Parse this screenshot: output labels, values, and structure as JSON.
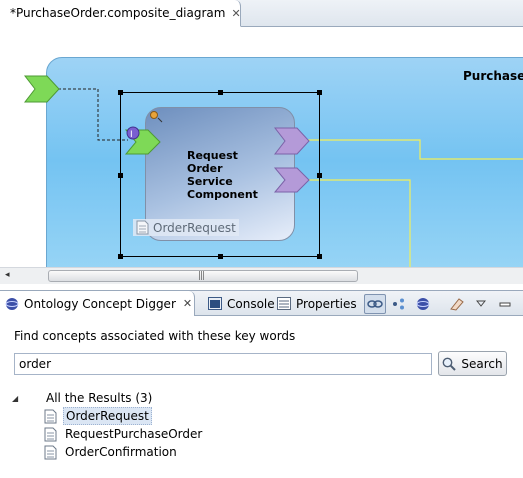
{
  "editor": {
    "tab_title": "*PurchaseOrder.composite_diagram",
    "tab_close": "✕"
  },
  "diagram": {
    "composite_title": "PurchaseO",
    "component_lines": [
      "Request",
      "Order",
      "Service",
      "Component"
    ],
    "implementation_label": "OrderRequest"
  },
  "scrollbar": {
    "left_arrow": "◂",
    "grip": "|||"
  },
  "views": {
    "active_tab": "Ontology Concept Digger",
    "active_close": "✕",
    "console_tab": "Console",
    "properties_tab": "Properties"
  },
  "digger": {
    "prompt": "Find concepts associated with these key words",
    "query": "order",
    "search_label": "Search",
    "results_root": "All the Results (3)",
    "results": [
      "OrderRequest",
      "RequestPurchaseOrder",
      "OrderConfirmation"
    ]
  },
  "colors": {
    "composite_fill": "#74c3f2",
    "component_fill": "#6e8fbe",
    "service_arrow": "#7ed957",
    "reference_arrow": "#b49ad8",
    "wire_yellow": "#f2ef5a",
    "selection_highlight": "#dbe6f4"
  }
}
